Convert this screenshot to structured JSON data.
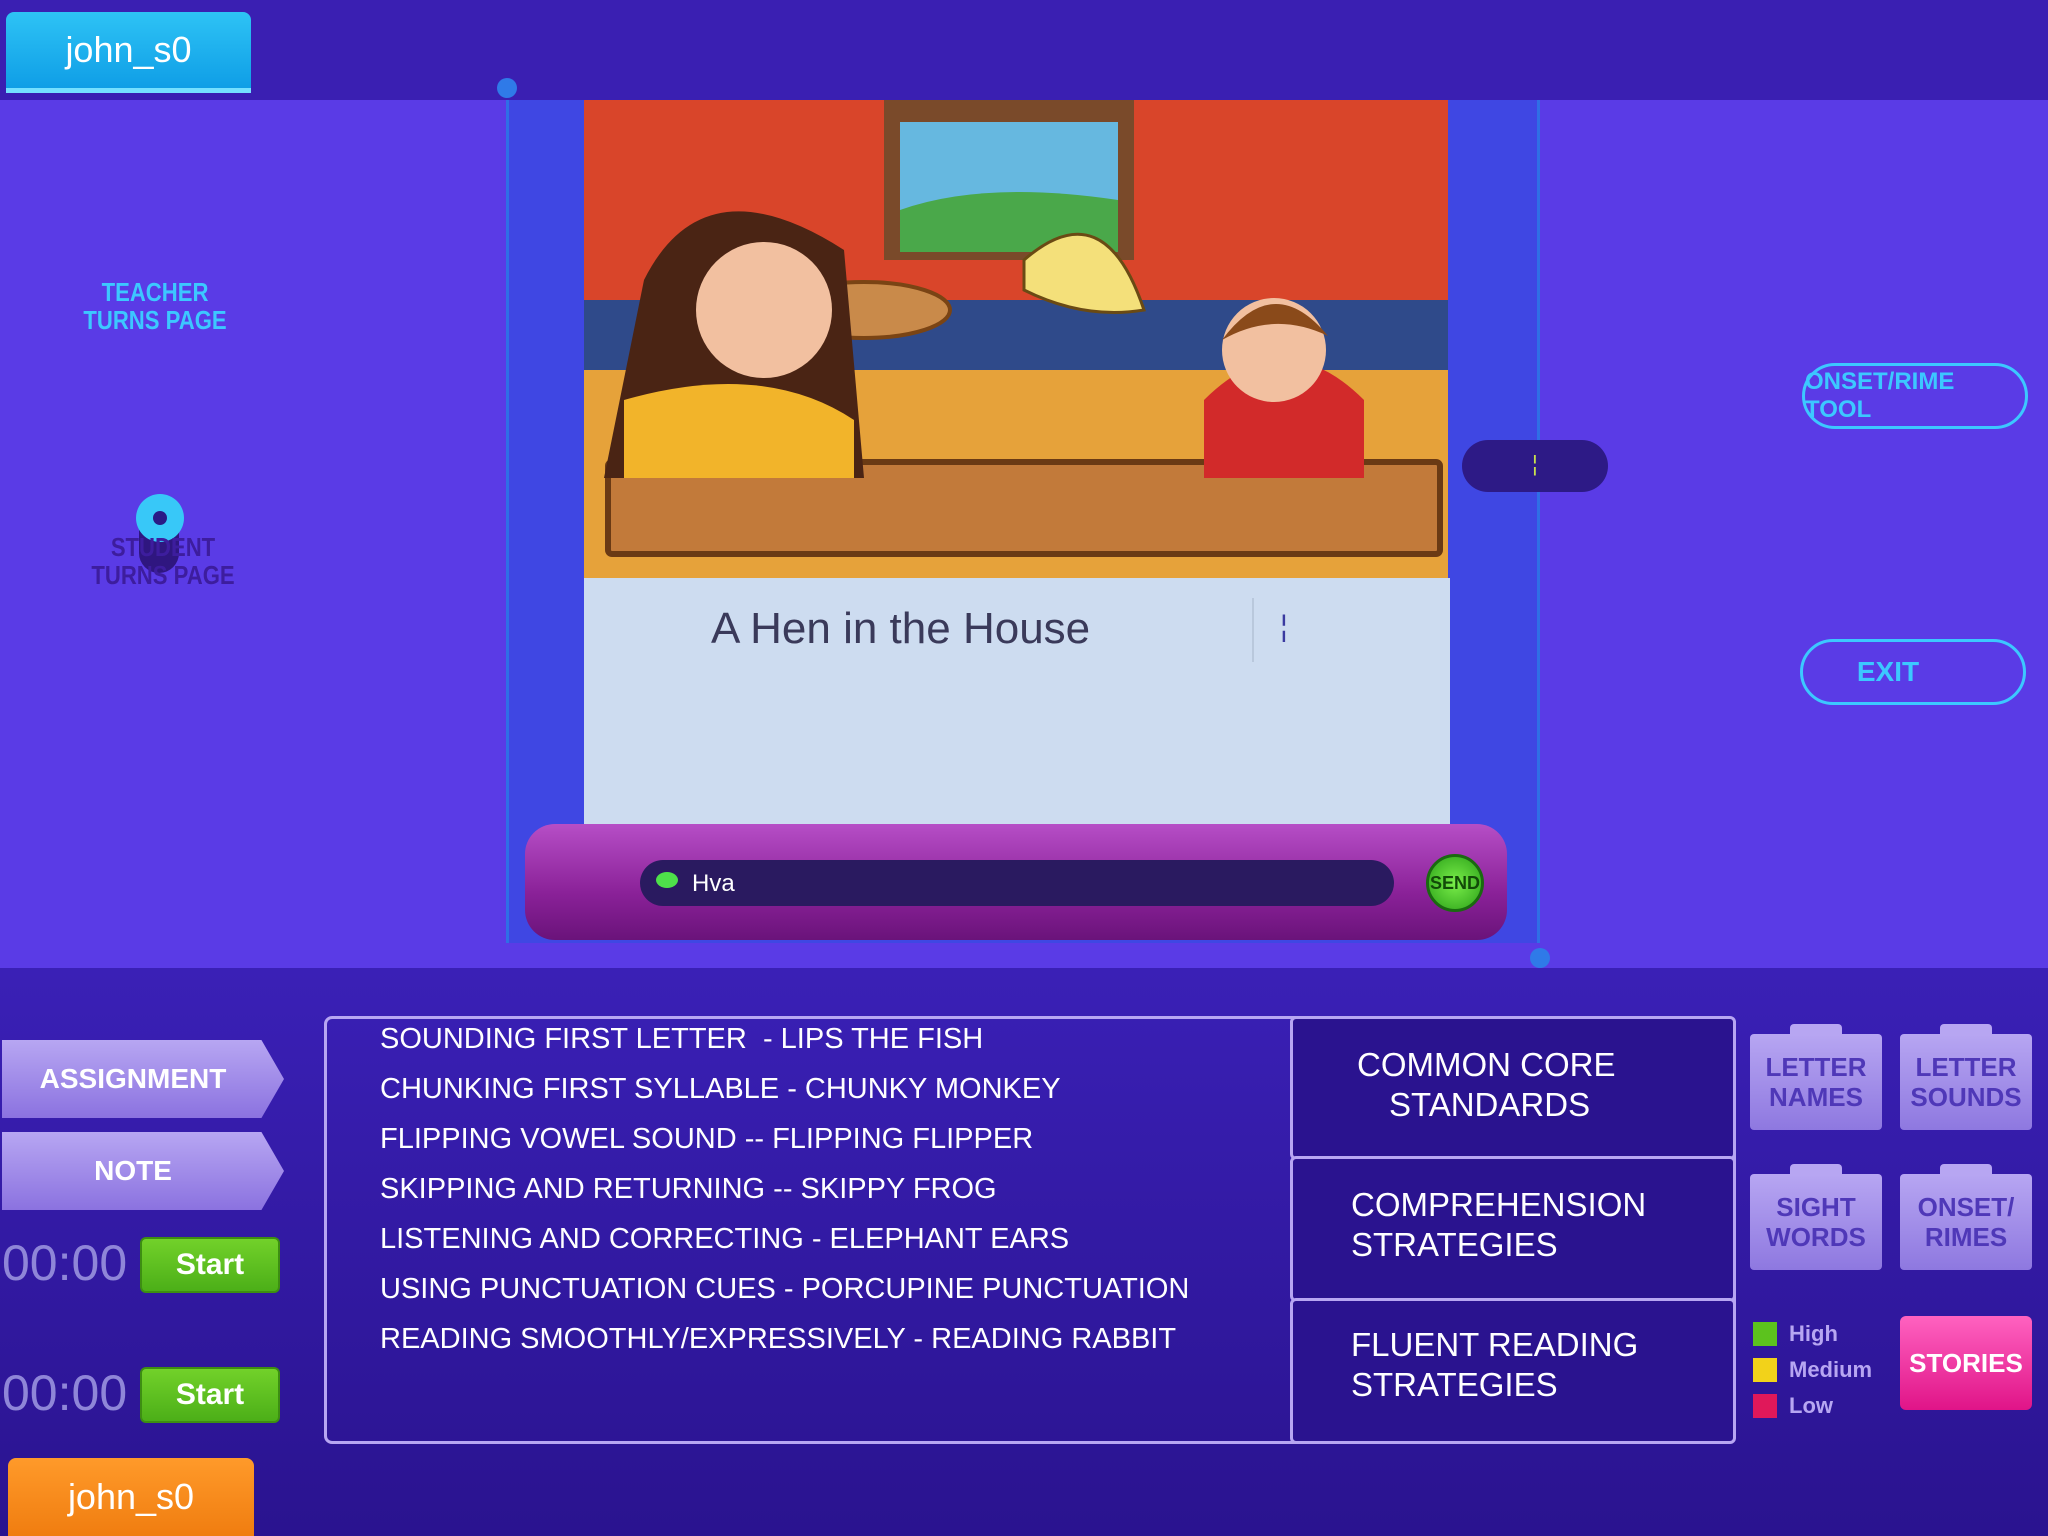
{
  "users": {
    "top": "john_s0",
    "bottom": "john_s0"
  },
  "page_turn": {
    "teacher_label": "TEACHER TURNS PAGE",
    "student_label": "STUDENT TURNS PAGE",
    "selected": "teacher"
  },
  "book": {
    "title": "A Hen in the House",
    "cursor": "¦"
  },
  "side_pill": {
    "marker": "¦"
  },
  "chat": {
    "text": "Hva",
    "send_label": "SEND"
  },
  "right_buttons": {
    "onset_rime": "ONSET/RIME TOOL",
    "exit": "EXIT"
  },
  "left_panel": {
    "assignment": "ASSIGNMENT",
    "note": "NOTE",
    "timers": [
      {
        "time": "00:00",
        "start": "Start"
      },
      {
        "time": "00:00",
        "start": "Start"
      }
    ]
  },
  "strategies": [
    "SOUNDING FIRST LETTER  - LIPS THE FISH",
    "CHUNKING FIRST SYLLABLE - CHUNKY MONKEY",
    "FLIPPING VOWEL SOUND -- FLIPPING FLIPPER",
    "SKIPPING AND RETURNING -- SKIPPY FROG",
    "LISTENING AND CORRECTING - ELEPHANT EARS",
    "USING PUNCTUATION CUES - PORCUPINE PUNCTUATION",
    "READING SMOOTHLY/EXPRESSIVELY - READING RABBIT"
  ],
  "categories": [
    {
      "line1": "COMMON CORE",
      "line2": "STANDARDS"
    },
    {
      "line1": "COMPREHENSION",
      "line2": "STRATEGIES"
    },
    {
      "line1": "FLUENT READING",
      "line2": "STRATEGIES"
    }
  ],
  "folders": [
    {
      "line1": "LETTER",
      "line2": "NAMES"
    },
    {
      "line1": "LETTER",
      "line2": "SOUNDS"
    },
    {
      "line1": "SIGHT",
      "line2": "WORDS"
    },
    {
      "line1": "ONSET/",
      "line2": "RIMES"
    }
  ],
  "legend": [
    {
      "label": "High",
      "color": "#5cc21e"
    },
    {
      "label": "Medium",
      "color": "#f2d21a"
    },
    {
      "label": "Low",
      "color": "#e0185a"
    }
  ],
  "stories_label": "STORIES",
  "colors": {
    "accent": "#3cc8ff",
    "background": "#5a3be6",
    "chat_bar": "#8a2198"
  }
}
